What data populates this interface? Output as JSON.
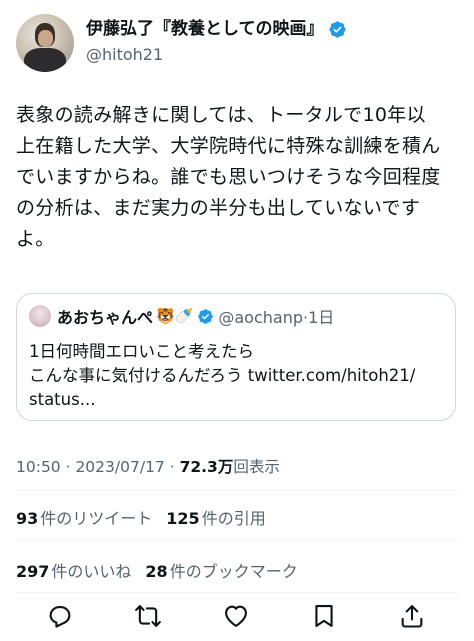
{
  "author": {
    "display_name": "伊藤弘了『教養としての映画』",
    "handle": "@hitoh21"
  },
  "tweet_text": "表象の読み解きに関しては、トータルで10年以\n上在籍した大学、大学院時代に特殊な訓練を積ん\nでいますからね。誰でも思いつけそうな今回程度\nの分析は、まだ実力の半分も出していないです\nよ。",
  "quoted": {
    "display_name": "あおちゃんぺ",
    "emoji": "🐯🍼",
    "handle_time": "@aochanp·1日",
    "text": "1日何時間エロいこと考えたら\nこんな事に気付けるんだろう twitter.com/hitoh21/\nstatus..."
  },
  "meta": {
    "time_date": "10:50 · 2023/07/17 · ",
    "views_count": "72.3万",
    "views_label": "回表示"
  },
  "stats": {
    "retweets_count": "93",
    "retweets_label": "件のリツイート",
    "quotes_count": "125",
    "quotes_label": "件の引用",
    "likes_count": "297",
    "likes_label": "件のいいね",
    "bookmarks_count": "28",
    "bookmarks_label": "件のブックマーク"
  },
  "actions": [
    "reply-icon",
    "retweet-icon",
    "like-icon",
    "bookmark-icon",
    "share-icon"
  ],
  "colors": {
    "verified": "#1d9bf0",
    "secondary_text": "#536471",
    "border": "#cfd9de"
  }
}
